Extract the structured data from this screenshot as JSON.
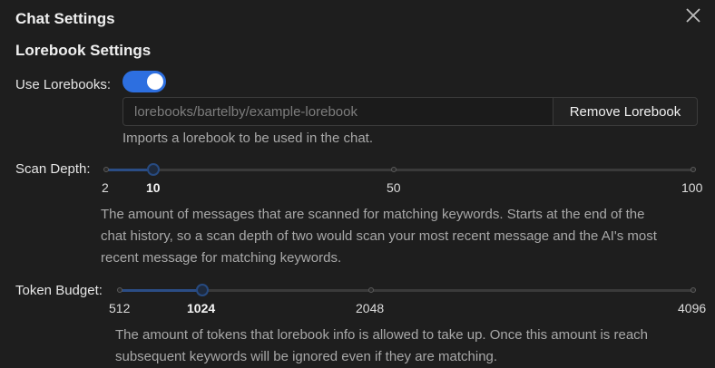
{
  "dialog": {
    "title": "Chat Settings",
    "close_icon": "close-icon"
  },
  "lorebook": {
    "section_title": "Lorebook Settings",
    "use_label": "Use Lorebooks:",
    "use_enabled": true,
    "path_placeholder": "lorebooks/bartelby/example-lorebook",
    "remove_label": "Remove Lorebook",
    "hint": "Imports a lorebook to be used in the chat."
  },
  "scan_depth": {
    "label": "Scan Depth:",
    "min": 2,
    "max": 100,
    "value": 10,
    "marks": [
      "2",
      "10",
      "50",
      "100"
    ],
    "description_lines": [
      "The amount of messages that are scanned for matching keywords. Starts at the end of the",
      "chat history, so a scan depth of two would scan your most recent message and the AI's most",
      "recent message for matching keywords."
    ]
  },
  "token_budget": {
    "label": "Token Budget:",
    "min": 512,
    "max": 4096,
    "value": 1024,
    "marks": [
      "512",
      "1024",
      "2048",
      "4096"
    ],
    "description_lines": [
      "The amount of tokens that lorebook info is allowed to take up. Once this amount is reach",
      "subsequent keywords will be ignored even if they are matching."
    ]
  },
  "colors": {
    "accent": "#2d6fe0",
    "background": "#1e1e1e"
  }
}
